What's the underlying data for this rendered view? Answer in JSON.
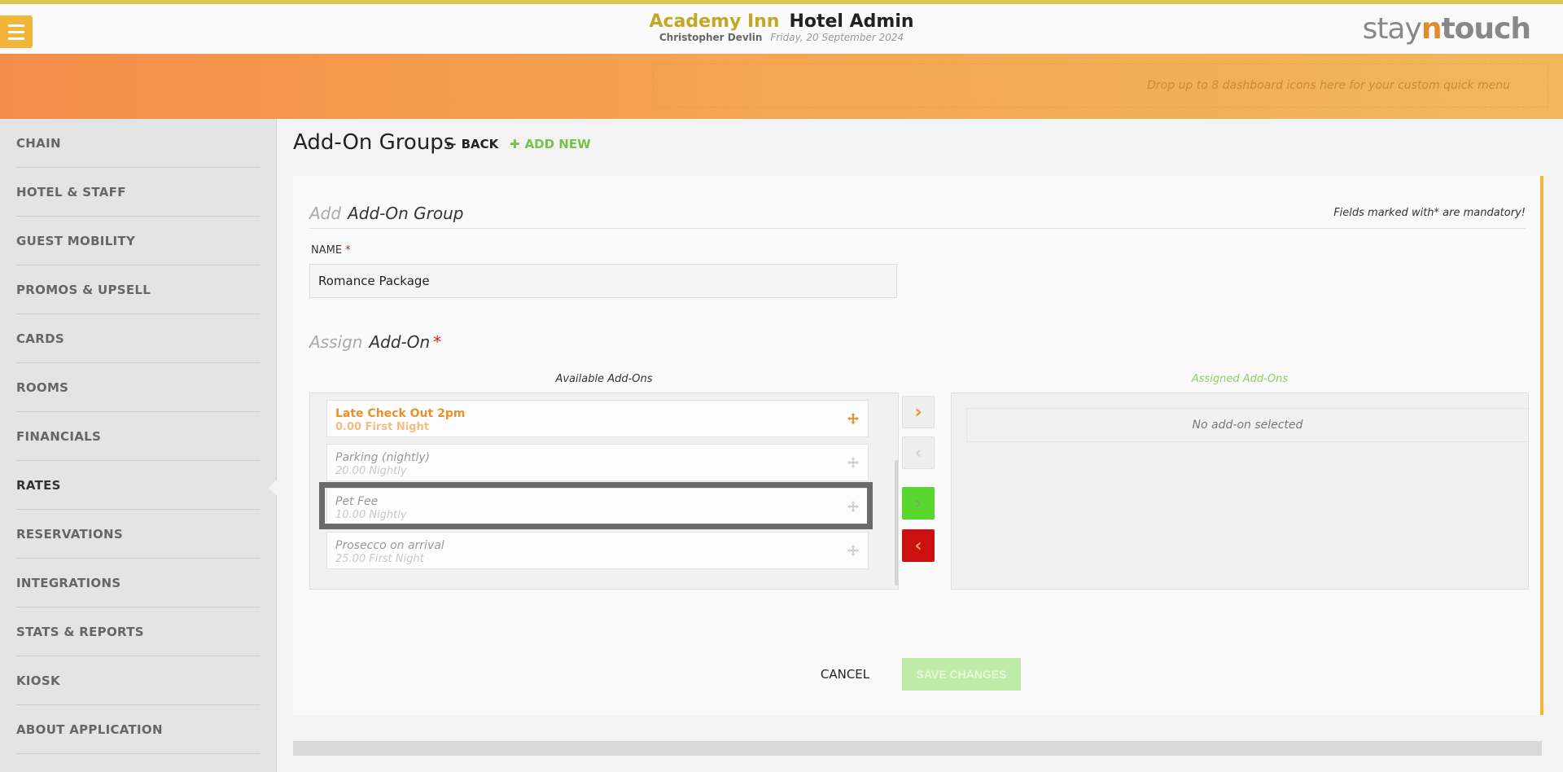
{
  "header": {
    "hotel_name": "Academy Inn",
    "module_name": "Hotel Admin",
    "user_name": "Christopher Devlin",
    "date": "Friday, 20 September 2024",
    "logo": {
      "part1": "stay",
      "part2": "n",
      "part3": "touch"
    },
    "menu_icon": "hamburger-icon"
  },
  "quickbar": {
    "hint": "Drop up to 8 dashboard icons here for your custom quick menu"
  },
  "sidebar": {
    "items": [
      {
        "label": "CHAIN"
      },
      {
        "label": "HOTEL & STAFF"
      },
      {
        "label": "GUEST MOBILITY"
      },
      {
        "label": "PROMOS & UPSELL"
      },
      {
        "label": "CARDS"
      },
      {
        "label": "ROOMS"
      },
      {
        "label": "FINANCIALS"
      },
      {
        "label": "RATES",
        "active": true
      },
      {
        "label": "RESERVATIONS"
      },
      {
        "label": "INTEGRATIONS"
      },
      {
        "label": "STATS & REPORTS"
      },
      {
        "label": "KIOSK"
      },
      {
        "label": "ABOUT APPLICATION"
      }
    ]
  },
  "page": {
    "title": "Add-On Groups",
    "back_label": "BACK",
    "add_new_label": "ADD NEW"
  },
  "form": {
    "head_prefix": "Add",
    "head_title": "Add-On Group",
    "mandatory_note": "Fields marked with* are mandatory!",
    "name_label": "NAME",
    "required_mark": "*",
    "name_value": "Romance Package",
    "assign_prefix": "Assign",
    "assign_title": "Add-On",
    "available_title": "Available Add-Ons",
    "assigned_title": "Assigned Add-Ons",
    "available_addons": [
      {
        "name": "Late Check Out 2pm",
        "price": "0.00 First Night"
      },
      {
        "name": "Parking (nightly)",
        "price": "20.00 Nightly"
      },
      {
        "name": "Pet Fee",
        "price": "10.00 Nightly"
      },
      {
        "name": "Prosecco on arrival",
        "price": "25.00 First Night"
      }
    ],
    "assigned_empty": "No add-on selected",
    "cancel_label": "CANCEL",
    "save_label": "SAVE CHANGES"
  },
  "colors": {
    "accent_orange": "#f2b53a",
    "brand_gold": "#c3a826",
    "green": "#7ac04c",
    "red": "#cc1010"
  }
}
